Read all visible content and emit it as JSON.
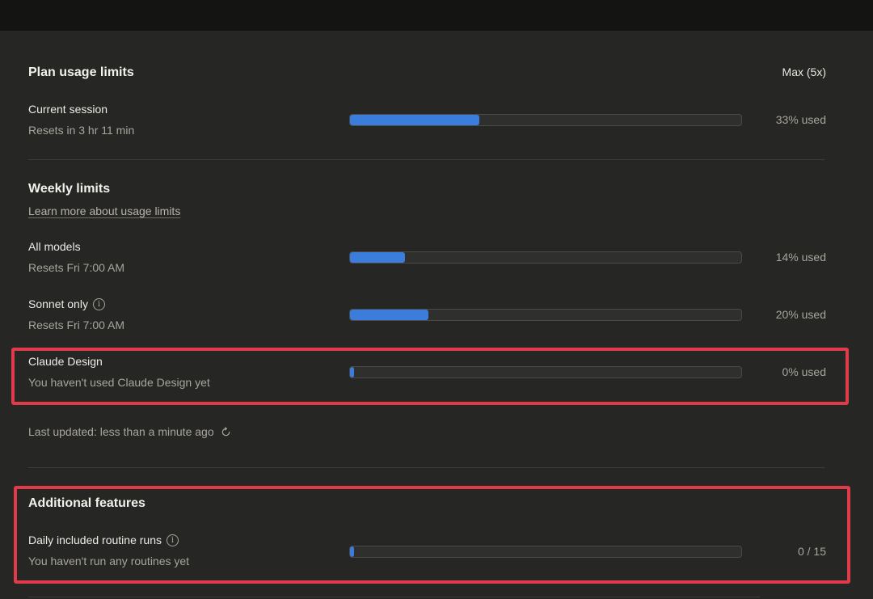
{
  "plan": {
    "title": "Plan usage limits",
    "badge": "Max (5x)",
    "current_session": {
      "label": "Current session",
      "sub": "Resets in 3 hr 11 min",
      "percent_text": "33% used",
      "fill": 0.33
    }
  },
  "weekly": {
    "title": "Weekly limits",
    "link": "Learn more about usage limits",
    "rows": [
      {
        "label": "All models",
        "sub": "Resets Fri 7:00 AM",
        "percent_text": "14% used",
        "fill": 0.14
      },
      {
        "label": "Sonnet only",
        "sub": "Resets Fri 7:00 AM",
        "percent_text": "20% used",
        "fill": 0.2
      },
      {
        "label": "Claude Design",
        "sub": "You haven't used Claude Design yet",
        "percent_text": "0% used",
        "fill": 0.01
      }
    ]
  },
  "last_updated": "Last updated: less than a minute ago",
  "additional": {
    "title": "Additional features",
    "row": {
      "label": "Daily included routine runs",
      "sub": "You haven't run any routines yet",
      "count_text": "0 / 15",
      "fill": 0.01
    }
  },
  "icons": {
    "info": "info-icon",
    "refresh": "refresh-icon"
  },
  "colors": {
    "accent": "#3b7ddd",
    "highlight": "#e03b48",
    "background": "#262624"
  }
}
